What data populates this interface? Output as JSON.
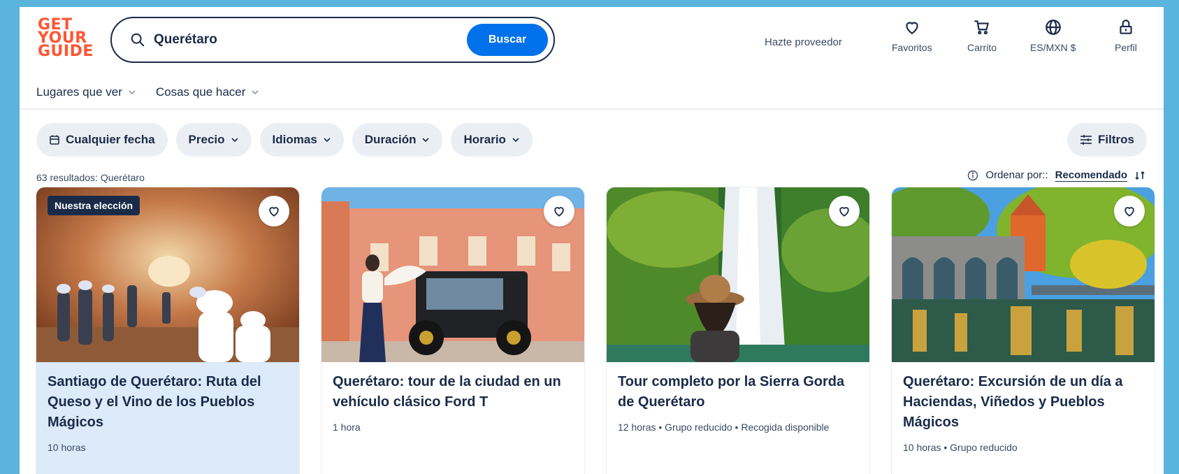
{
  "brand": {
    "logo_lines": [
      "GET",
      "YOUR",
      "GUIDE"
    ],
    "color": "#ff5533"
  },
  "search": {
    "value": "Querétaro",
    "placeholder": "",
    "button_label": "Buscar"
  },
  "header": {
    "provider_link": "Hazte proveedor",
    "actions": [
      {
        "label": "Favoritos",
        "icon": "heart-icon"
      },
      {
        "label": "Carrito",
        "icon": "cart-icon"
      },
      {
        "label": "ES/MXN $",
        "icon": "globe-icon"
      },
      {
        "label": "Perfil",
        "icon": "profile-icon"
      }
    ]
  },
  "nav": {
    "items": [
      {
        "label": "Lugares que ver"
      },
      {
        "label": "Cosas que hacer"
      }
    ]
  },
  "filters": {
    "chips": [
      {
        "label": "Cualquier fecha",
        "icon": "calendar-icon"
      },
      {
        "label": "Precio"
      },
      {
        "label": "Idiomas"
      },
      {
        "label": "Duración"
      },
      {
        "label": "Horario"
      }
    ],
    "filters_button": "Filtros"
  },
  "results": {
    "summary": "63 resultados: Querétaro",
    "sort_label": "Ordenar por::",
    "sort_value": "Recomendado"
  },
  "cards": [
    {
      "badge": "Nuestra elección",
      "title": "Santiago de Querétaro: Ruta del Queso y el Vino de los Pueblos Mágicos",
      "meta": "10 horas"
    },
    {
      "title": "Querétaro: tour de la ciudad en un vehículo clásico Ford T",
      "meta": "1 hora"
    },
    {
      "title": "Tour completo por la Sierra Gorda de Querétaro",
      "meta": "12 horas • Grupo reducido • Recogida disponible"
    },
    {
      "title": "Querétaro: Excursión de un día a Haciendas, Viñedos y Pueblos Mágicos",
      "meta": "10 horas • Grupo reducido"
    }
  ],
  "colors": {
    "accent": "#0071eb",
    "text": "#1a2b49",
    "highlight": "#dceaf9",
    "background": "#5ab4dc"
  }
}
